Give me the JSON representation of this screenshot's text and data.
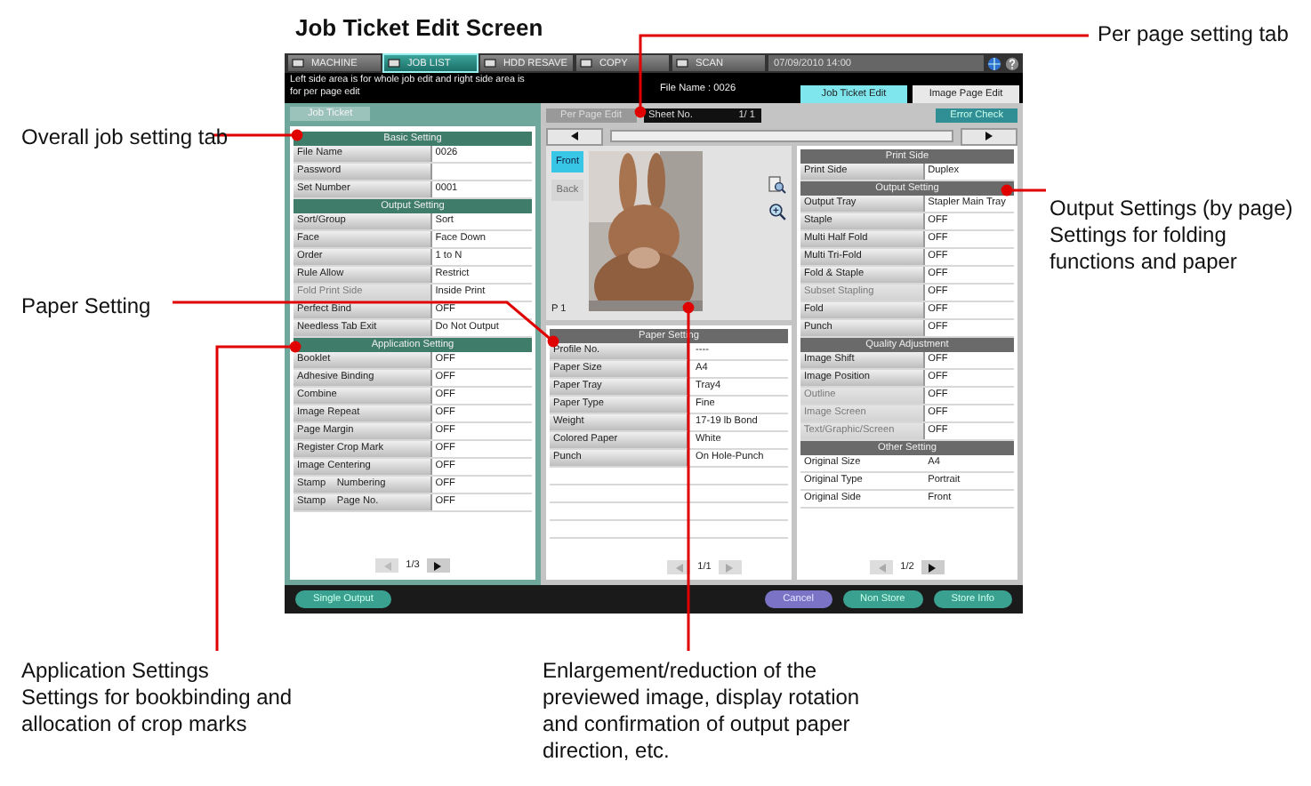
{
  "page_title": "Job Ticket Edit Screen",
  "screen": {
    "top_tabs": [
      {
        "label": "MACHINE",
        "selected": false
      },
      {
        "label": "JOB LIST",
        "selected": true
      },
      {
        "label": "HDD RESAVE",
        "selected": false
      },
      {
        "label": "COPY",
        "selected": false
      },
      {
        "label": "SCAN",
        "selected": false
      }
    ],
    "datetime": "07/09/2010 14:00",
    "message": "Left side area is for whole job edit and right side area is for per page edit",
    "file_name": "File Name : 0026",
    "edit_tabs": [
      {
        "label": "Job Ticket Edit",
        "selected": true
      },
      {
        "label": "Image Page Edit",
        "selected": false
      }
    ],
    "job_ticket": {
      "tab": "Job Ticket",
      "page": "1/3",
      "sections": [
        {
          "title": "Basic Setting",
          "rows": [
            {
              "kind": "button",
              "label": "File Name",
              "value": "0026",
              "disabled": false
            },
            {
              "kind": "button",
              "label": "Password",
              "disabled": false
            },
            {
              "kind": "button",
              "label": "Set Number",
              "value": "0001",
              "disabled": false
            }
          ]
        },
        {
          "title": "Output Setting",
          "rows": [
            {
              "kind": "button",
              "label": "Sort/Group",
              "value": "Sort",
              "disabled": false
            },
            {
              "kind": "button",
              "label": "Face",
              "value": "Face Down",
              "disabled": false
            },
            {
              "kind": "button",
              "label": "Order",
              "value": "1 to N",
              "disabled": false
            },
            {
              "kind": "button",
              "label": "Rule Allow",
              "value": "Restrict",
              "disabled": false
            },
            {
              "kind": "button",
              "label": "Fold Print Side",
              "value": "Inside Print",
              "disabled": true
            },
            {
              "kind": "button",
              "label": "Perfect Bind",
              "value": "OFF",
              "disabled": false
            },
            {
              "kind": "button",
              "label": "Needless Tab Exit",
              "value": "Do Not Output",
              "disabled": false
            }
          ]
        },
        {
          "title": "Application Setting",
          "rows": [
            {
              "kind": "button",
              "label": "Booklet",
              "value": "OFF",
              "disabled": false
            },
            {
              "kind": "button",
              "label": "Adhesive Binding",
              "value": "OFF",
              "disabled": false
            },
            {
              "kind": "button",
              "label": "Combine",
              "value": "OFF",
              "disabled": false
            },
            {
              "kind": "button",
              "label": "Image Repeat",
              "value": "OFF",
              "disabled": false
            },
            {
              "kind": "button",
              "label": "Page Margin",
              "value": "OFF",
              "disabled": false
            },
            {
              "kind": "button",
              "label": "Register Crop Mark",
              "value": "OFF",
              "disabled": false
            },
            {
              "kind": "button",
              "label": "Image Centering",
              "value": "OFF",
              "disabled": false
            },
            {
              "kind": "button",
              "label": "Stamp    Numbering",
              "value": "OFF",
              "disabled": false
            },
            {
              "kind": "button",
              "label": "Stamp    Page No.",
              "value": "OFF",
              "disabled": false
            }
          ]
        }
      ]
    },
    "per_page": {
      "tab": "Per Page Edit",
      "sheet_label": "Sheet No.",
      "sheet_value": "1/ 1",
      "sides": [
        {
          "label": "Front",
          "selected": true
        },
        {
          "label": "Back",
          "selected": false
        }
      ],
      "page_marker": "P 1",
      "page": "1/1",
      "sections": [
        {
          "title": "Paper Setting",
          "rows": [
            {
              "kind": "button",
              "label": "Profile No.",
              "value": "----",
              "disabled": false
            },
            {
              "kind": "button",
              "label": "Paper Size",
              "value": "A4",
              "disabled": false
            },
            {
              "kind": "button",
              "label": "Paper Tray",
              "value": "Tray4",
              "disabled": false
            },
            {
              "kind": "button",
              "label": "Paper Type",
              "value": "Fine",
              "disabled": false
            },
            {
              "kind": "button",
              "label": "Weight",
              "value": "17-19 lb Bond",
              "disabled": false
            },
            {
              "kind": "button",
              "label": "Colored Paper",
              "value": "White",
              "disabled": false
            },
            {
              "kind": "button",
              "label": "Punch",
              "value": "On Hole-Punch",
              "disabled": false
            }
          ]
        }
      ]
    },
    "page_settings": {
      "error_check": "Error Check",
      "page": "1/2",
      "sections": [
        {
          "title": "Print Side",
          "rows": [
            {
              "kind": "button",
              "label": "Print Side",
              "value": "Duplex",
              "disabled": false
            }
          ]
        },
        {
          "title": "Output Setting",
          "rows": [
            {
              "kind": "button",
              "label": "Output Tray",
              "value": "Stapler Main Tray",
              "disabled": false
            },
            {
              "kind": "button",
              "label": "Staple",
              "value": "OFF",
              "disabled": false
            },
            {
              "kind": "button",
              "label": "Multi Half Fold",
              "value": "OFF",
              "disabled": false
            },
            {
              "kind": "button",
              "label": "Multi Tri-Fold",
              "value": "OFF",
              "disabled": false
            },
            {
              "kind": "button",
              "label": "Fold & Staple",
              "value": "OFF",
              "disabled": false
            },
            {
              "kind": "button",
              "label": "Subset Stapling",
              "value": "OFF",
              "disabled": true
            },
            {
              "kind": "button",
              "label": "Fold",
              "value": "OFF",
              "disabled": false
            },
            {
              "kind": "button",
              "label": "Punch",
              "value": "OFF",
              "disabled": false
            }
          ]
        },
        {
          "title": "Quality Adjustment",
          "rows": [
            {
              "kind": "button",
              "label": "Image Shift",
              "value": "OFF",
              "disabled": false
            },
            {
              "kind": "button",
              "label": "Image Position",
              "value": "OFF",
              "disabled": false
            },
            {
              "kind": "button",
              "label": "Outline",
              "value": "OFF",
              "disabled": true
            },
            {
              "kind": "button",
              "label": "Image Screen",
              "value": "OFF",
              "disabled": true
            },
            {
              "kind": "button",
              "label": "Text/Graphic/Screen",
              "value": "OFF",
              "disabled": true
            }
          ]
        },
        {
          "title": "Other Setting",
          "rows": [
            {
              "kind": "text",
              "label": "Original Size",
              "value": "A4",
              "disabled": false
            },
            {
              "kind": "text",
              "label": "Original Type",
              "value": "Portrait",
              "disabled": false
            },
            {
              "kind": "text",
              "label": "Original Side",
              "value": "Front",
              "disabled": false
            }
          ]
        }
      ]
    },
    "bottom_buttons": [
      {
        "label": "Single Output",
        "kind": "left"
      },
      {
        "label": "Cancel",
        "kind": "cancel"
      },
      {
        "label": "Non Store",
        "kind": "right"
      },
      {
        "label": "Store Info",
        "kind": "right"
      }
    ]
  },
  "callouts": [
    {
      "title": "Overall job setting tab"
    },
    {
      "title": "Per page setting tab"
    },
    {
      "title": "Paper Setting"
    },
    {
      "title": "Output Settings (by page)",
      "text": "Settings for folding functions and paper"
    },
    {
      "title": "Application Settings",
      "text": "Settings for bookbinding and allocation of crop marks"
    },
    {
      "title": "Enlargement/reduction of the previewed image, display rotation and confirmation of output paper direction, etc."
    }
  ]
}
